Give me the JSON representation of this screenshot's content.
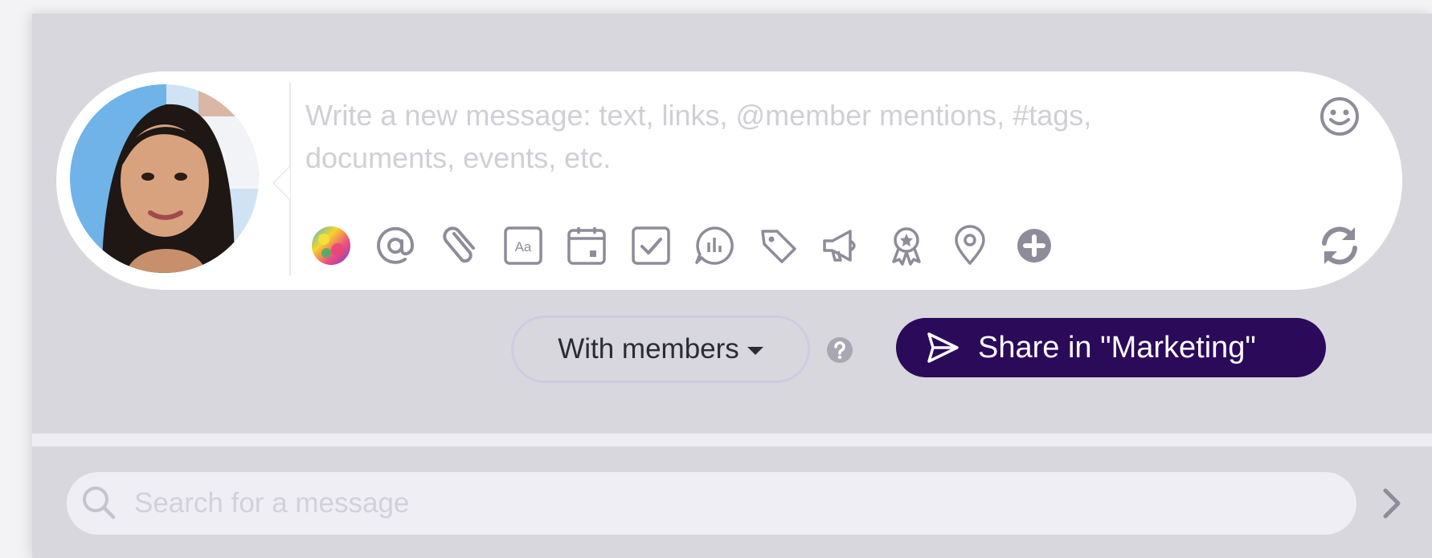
{
  "composer": {
    "placeholder": "Write a new message: text, links, @member mentions, #tags, documents, events, etc.",
    "toolbar_icons": [
      "color-wheel-icon",
      "at-mention-icon",
      "paperclip-icon",
      "text-format-icon",
      "calendar-icon",
      "checkbox-icon",
      "poll-icon",
      "tag-icon",
      "megaphone-icon",
      "award-icon",
      "location-pin-icon",
      "plus-circle-icon"
    ],
    "emoji_icon": "smiley-icon",
    "refresh_icon": "refresh-icon"
  },
  "actions": {
    "visibility_label": "With members",
    "share_label": "Share in \"Marketing\""
  },
  "search": {
    "placeholder": "Search for a message"
  },
  "colors": {
    "panel_bg": "#d8d7de",
    "share_button": "#2b0a5a",
    "icon_gray": "#8e8c99"
  }
}
